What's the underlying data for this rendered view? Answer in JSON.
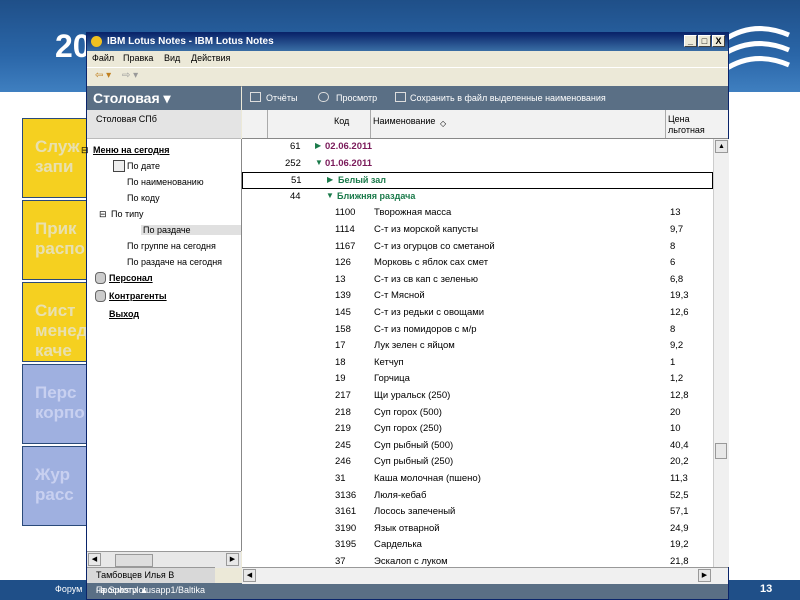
{
  "slide": {
    "title": "20",
    "left_boxes": [
      {
        "line1": "Служ",
        "line2": "запи",
        "color": "#f5d020",
        "text_color": "#e8e0b0"
      },
      {
        "line1": "Прик",
        "line2": "распор",
        "color": "#f5d020",
        "text_color": "#e8e0b0"
      },
      {
        "line1": "Сист",
        "line2": "менедж",
        "line3": "каче",
        "color": "#f5d020",
        "text_color": "#e8e0b0"
      },
      {
        "line1": "Перс",
        "line2": "корпо",
        "color": "#9fb0e0",
        "text_color": "#c8d0f0"
      },
      {
        "line1": "Жур",
        "line2": "расс",
        "color": "#9fb0e0",
        "text_color": "#c8d0f0"
      }
    ],
    "footer_left": "Форум",
    "page_number": "13"
  },
  "window": {
    "title": "IBM Lotus Notes - IBM Lotus Notes",
    "buttons": {
      "minimize": "_",
      "maximize": "□",
      "close": "X"
    },
    "menu": [
      "Файл",
      "Правка",
      "Вид",
      "Действия"
    ]
  },
  "navigator": {
    "header": "Столовая ▾",
    "subtitle": "Столовая СПб",
    "items": [
      {
        "label": "Меню на сегодня",
        "bold": true,
        "prefix": "⊟"
      },
      {
        "label": "По дате",
        "bold": false
      },
      {
        "label": "По наименованию",
        "bold": false
      },
      {
        "label": "По коду",
        "bold": false
      },
      {
        "label": "По типу",
        "bold": false,
        "prefix": "⊟"
      },
      {
        "label": "По раздаче",
        "bold": false,
        "selected": true
      },
      {
        "label": "По группе на сегодня",
        "bold": false
      },
      {
        "label": "По раздаче на сегодня",
        "bold": false
      },
      {
        "label": "Персонал",
        "bold": true
      },
      {
        "label": "Контрагенты",
        "bold": true
      },
      {
        "label": "Выход",
        "bold": true
      }
    ],
    "user": "Тамбовцев Илья В",
    "server": "на Spbsrvlotusapp1/Baltika",
    "preview_label": "Просмотр ▲"
  },
  "view": {
    "toolbar": {
      "reports": "Отчёты",
      "preview": "Просмотр",
      "save": "Сохранить в файл выделенные наименования"
    },
    "columns": {
      "code": "Код",
      "name": "Наименование",
      "price_line1": "Цена",
      "price_line2": "льготная"
    },
    "rows": [
      {
        "type": "cat1",
        "count": "61",
        "label": "02.06.2011",
        "expanded": false
      },
      {
        "type": "cat1",
        "count": "252",
        "label": "01.06.2011",
        "expanded": true
      },
      {
        "type": "cat2",
        "count": "51",
        "label": "Белый зал",
        "expanded": false,
        "selected": true
      },
      {
        "type": "cat2",
        "count": "44",
        "label": "Ближняя раздача",
        "expanded": true
      },
      {
        "type": "item",
        "code": "1100",
        "name": "Творожная масса",
        "price": "13"
      },
      {
        "type": "item",
        "code": "1114",
        "name": "С-т из морской капусты",
        "price": "9,7"
      },
      {
        "type": "item",
        "code": "1167",
        "name": "С-т из огурцов со сметаной",
        "price": "8"
      },
      {
        "type": "item",
        "code": "126",
        "name": "Морковь с яблок сах смет",
        "price": "6"
      },
      {
        "type": "item",
        "code": "13",
        "name": "С-т из св кап с зеленью",
        "price": "6,8"
      },
      {
        "type": "item",
        "code": "139",
        "name": "С-т Мясной",
        "price": "19,3"
      },
      {
        "type": "item",
        "code": "145",
        "name": "С-т из редьки с овощами",
        "price": "12,6"
      },
      {
        "type": "item",
        "code": "158",
        "name": "С-т из помидоров с м/р",
        "price": "8"
      },
      {
        "type": "item",
        "code": "17",
        "name": "Лук зелен с яйцом",
        "price": "9,2"
      },
      {
        "type": "item",
        "code": "18",
        "name": "Кетчуп",
        "price": "1"
      },
      {
        "type": "item",
        "code": "19",
        "name": "Горчица",
        "price": "1,2"
      },
      {
        "type": "item",
        "code": "217",
        "name": "Щи уральск (250)",
        "price": "12,8"
      },
      {
        "type": "item",
        "code": "218",
        "name": "Суп горох (500)",
        "price": "20"
      },
      {
        "type": "item",
        "code": "219",
        "name": "Суп горох (250)",
        "price": "10"
      },
      {
        "type": "item",
        "code": "245",
        "name": "Суп рыбный (500)",
        "price": "40,4"
      },
      {
        "type": "item",
        "code": "246",
        "name": "Суп рыбный (250)",
        "price": "20,2"
      },
      {
        "type": "item",
        "code": "31",
        "name": "Каша молочная (пшено)",
        "price": "11,3"
      },
      {
        "type": "item",
        "code": "3136",
        "name": "Люля-кебаб",
        "price": "52,5"
      },
      {
        "type": "item",
        "code": "3161",
        "name": "Лосось запеченый",
        "price": "57,1"
      },
      {
        "type": "item",
        "code": "3190",
        "name": "Язык отварной",
        "price": "24,9"
      },
      {
        "type": "item",
        "code": "3195",
        "name": "Сарделька",
        "price": "19,2"
      },
      {
        "type": "item",
        "code": "37",
        "name": "Эскалоп с луком",
        "price": "21,8"
      }
    ]
  }
}
